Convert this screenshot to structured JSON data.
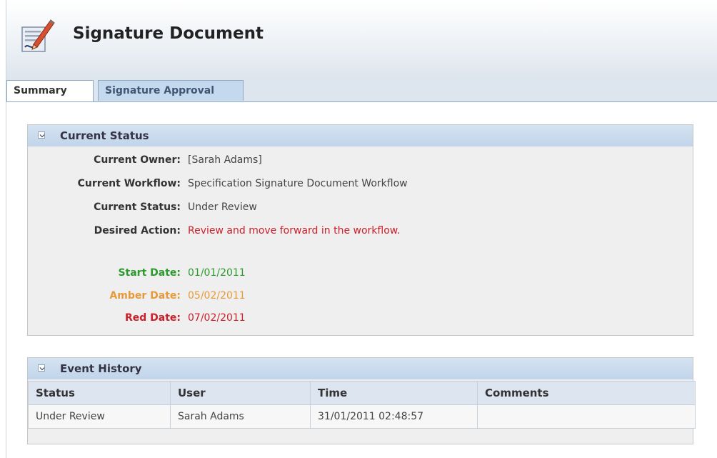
{
  "header": {
    "title": "Signature Document",
    "icon": "signature-document-icon"
  },
  "tabs": [
    {
      "label": "Summary",
      "active": true
    },
    {
      "label": "Signature Approval",
      "active": false
    }
  ],
  "current_status": {
    "title": "Current Status",
    "fields": [
      {
        "label": "Current Owner:",
        "value": "[Sarah Adams]"
      },
      {
        "label": "Current Workflow:",
        "value": "Specification Signature Document Workflow"
      },
      {
        "label": "Current Status:",
        "value": "Under Review"
      },
      {
        "label": "Desired Action:",
        "value": "Review and move forward in the workflow."
      }
    ],
    "dates": [
      {
        "label": "Start Date:",
        "value": "01/01/2011",
        "color": "#2d9a2d"
      },
      {
        "label": "Amber Date:",
        "value": "05/02/2011",
        "color": "#e69a39"
      },
      {
        "label": "Red Date:",
        "value": "07/02/2011",
        "color": "#cc1f29"
      }
    ]
  },
  "event_history": {
    "title": "Event History",
    "columns": [
      "Status",
      "User",
      "Time",
      "Comments"
    ],
    "rows": [
      [
        "Under Review",
        "Sarah Adams",
        "31/01/2011 02:48:57",
        ""
      ]
    ]
  }
}
